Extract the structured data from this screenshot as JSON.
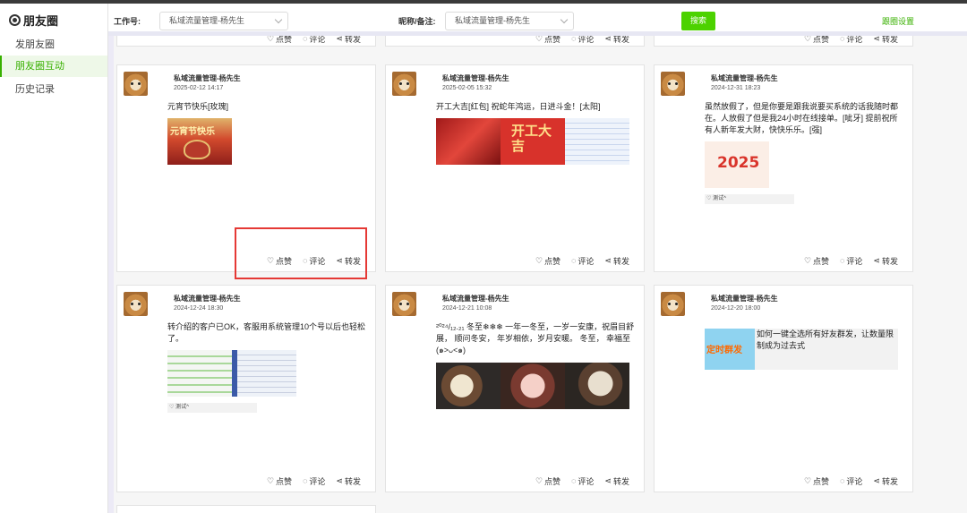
{
  "sidebar": {
    "brand": "朋友圈",
    "items": [
      {
        "label": "发朋友圈",
        "active": false
      },
      {
        "label": "朋友圈互动",
        "active": true
      },
      {
        "label": "历史记录",
        "active": false
      }
    ]
  },
  "filters": {
    "account_label": "工作号:",
    "account_value": "私域流量管理-杨先生",
    "nickname_label": "昵称/备注:",
    "nickname_value": "私域流量管理-杨先生",
    "search_button": "搜索",
    "settings_link": "跟圈设置"
  },
  "actions": {
    "like": "点赞",
    "comment": "评论",
    "share": "转发"
  },
  "posts": [
    {
      "author": "私域流量管理-杨先生",
      "date": "2025-02-12 14:17",
      "text": "元宵节快乐[玫瑰]",
      "likes": ""
    },
    {
      "author": "私域流量管理-杨先生",
      "date": "2025-02-05 15:32",
      "text": "开工大吉[红包] 祝蛇年鸿运，日进斗金！[太阳]",
      "likes": ""
    },
    {
      "author": "私域流量管理-杨先生",
      "date": "2024-12-31 18:23",
      "text": "虽然放假了，但是你要是跟我说要买系统的话我随时都在。人放假了但是我24小时在线接单。[呲牙] 提前祝所有人新年发大财，快快乐乐。[强]",
      "likes": "测试^"
    },
    {
      "author": "私域流量管理-杨先生",
      "date": "2024-12-24 18:30",
      "text": "转介绍的客户已OK，客服用系统管理10个号以后也轻松了。",
      "likes": "测试^"
    },
    {
      "author": "私域流量管理-杨先生",
      "date": "2024-12-21 10:08",
      "text": "²⁰²⁴/₁₂.₂₁ 冬至❄❄❄ 一年一冬至，一岁一安康，祝眉目舒展， 顺问冬安， 年岁相依，岁月安暖。 冬至， 幸福至(๑>ᴗ<๑)",
      "likes": ""
    },
    {
      "author": "私域流量管理-杨先生",
      "date": "2024-12-20 18:00",
      "text": "如何一键全选所有好友群发，让数量限制成为过去式",
      "likes": ""
    }
  ],
  "image_captions": {
    "lantern": "元宵节快乐",
    "kaigong": "开工大吉",
    "newyear": "2025",
    "timed": "定时群发"
  },
  "colors": {
    "accent": "#4cd200",
    "active_text": "#38b000",
    "highlight": "#e53935"
  },
  "icons": {
    "like": "heart-icon",
    "comment": "comment-icon",
    "share": "share-icon"
  }
}
